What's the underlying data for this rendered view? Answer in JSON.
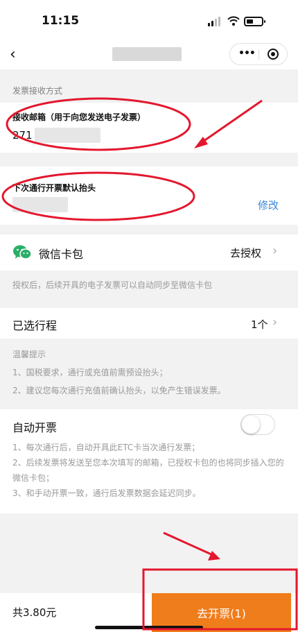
{
  "status": {
    "time": "11:15"
  },
  "nav": {
    "back_icon": "‹",
    "more_icon": "•••"
  },
  "receive": {
    "section_label": "发票接收方式",
    "email_label": "接收邮箱（用于向您发送电子发票）",
    "email_prefix": "271"
  },
  "invoice_title": {
    "label": "下次通行开票默认抬头",
    "edit_label": "修改"
  },
  "wechat": {
    "label": "微信卡包",
    "action": "去授权",
    "note": "授权后，后续开具的电子发票可以自动同步至微信卡包"
  },
  "journey": {
    "label": "已选行程",
    "count": "1个"
  },
  "tips": {
    "title": "温馨提示",
    "items": [
      "1、国税要求，通行或充值前需预设抬头；",
      "2、建议您每次通行充值前确认抬头，以免产生错误发票。"
    ]
  },
  "auto_invoice": {
    "label": "自动开票",
    "enabled": false,
    "desc": [
      "1、每次通行后，自动开具此ETC卡当次通行发票；",
      "2、后续发票将发送至您本次填写的邮箱，已授权卡包的也将同步插入您的微信卡包；",
      "3、和手动开票一致，通行后发票数据会延迟同步。"
    ]
  },
  "footer": {
    "total": "共3.80元",
    "button": "去开票(1)"
  },
  "colors": {
    "accent": "#f07d1b",
    "link": "#3a86d8",
    "annotation": "#e3172d",
    "wechat": "#2aae67"
  }
}
